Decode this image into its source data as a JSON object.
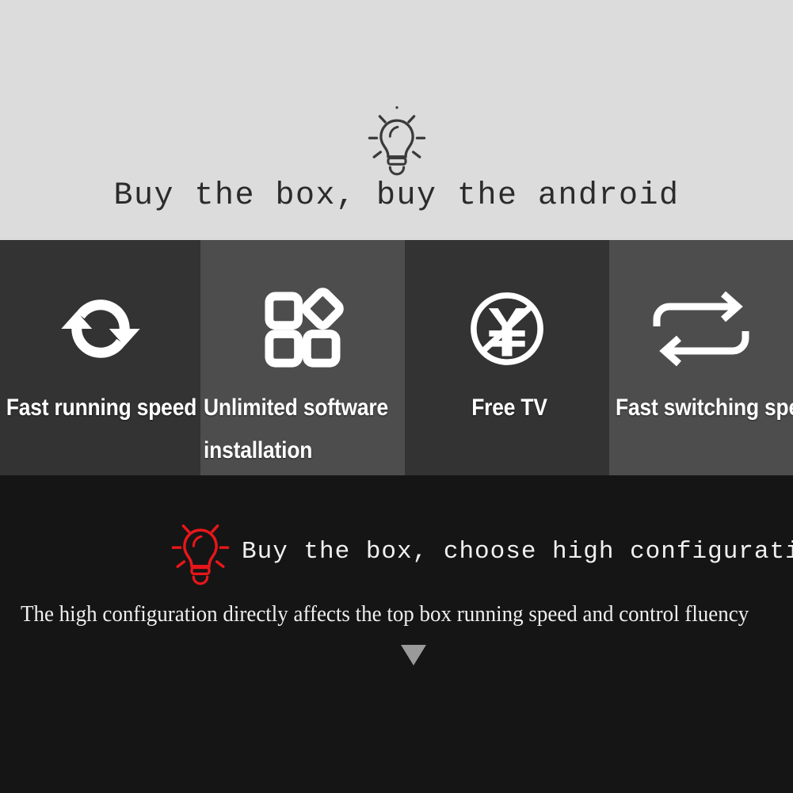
{
  "top_banner": {
    "icon": "lightbulb-icon",
    "title": "Buy the box, buy the android",
    "background_color": "#dcdcdc",
    "text_color": "#2b2b2b"
  },
  "features": [
    {
      "icon": "refresh-sync-icon",
      "label": "Fast running speed",
      "background_color": "#333333"
    },
    {
      "icon": "apps-grid-icon",
      "label": "Unlimited software installation",
      "background_color": "#4d4d4d"
    },
    {
      "icon": "no-money-yen-icon",
      "label": "Free TV",
      "background_color": "#333333"
    },
    {
      "icon": "switch-arrows-icon",
      "label": "Fast switching speed",
      "background_color": "#4d4d4d"
    }
  ],
  "bottom_banner": {
    "icon": "lightbulb-icon-red",
    "icon_color": "#e8161a",
    "title": "Buy the box, choose high configuration",
    "subtitle": "The high configuration directly affects the top box running speed and control fluency",
    "scroll_indicator": "down-triangle-icon",
    "background_color": "#151515",
    "text_color": "#efefef"
  }
}
